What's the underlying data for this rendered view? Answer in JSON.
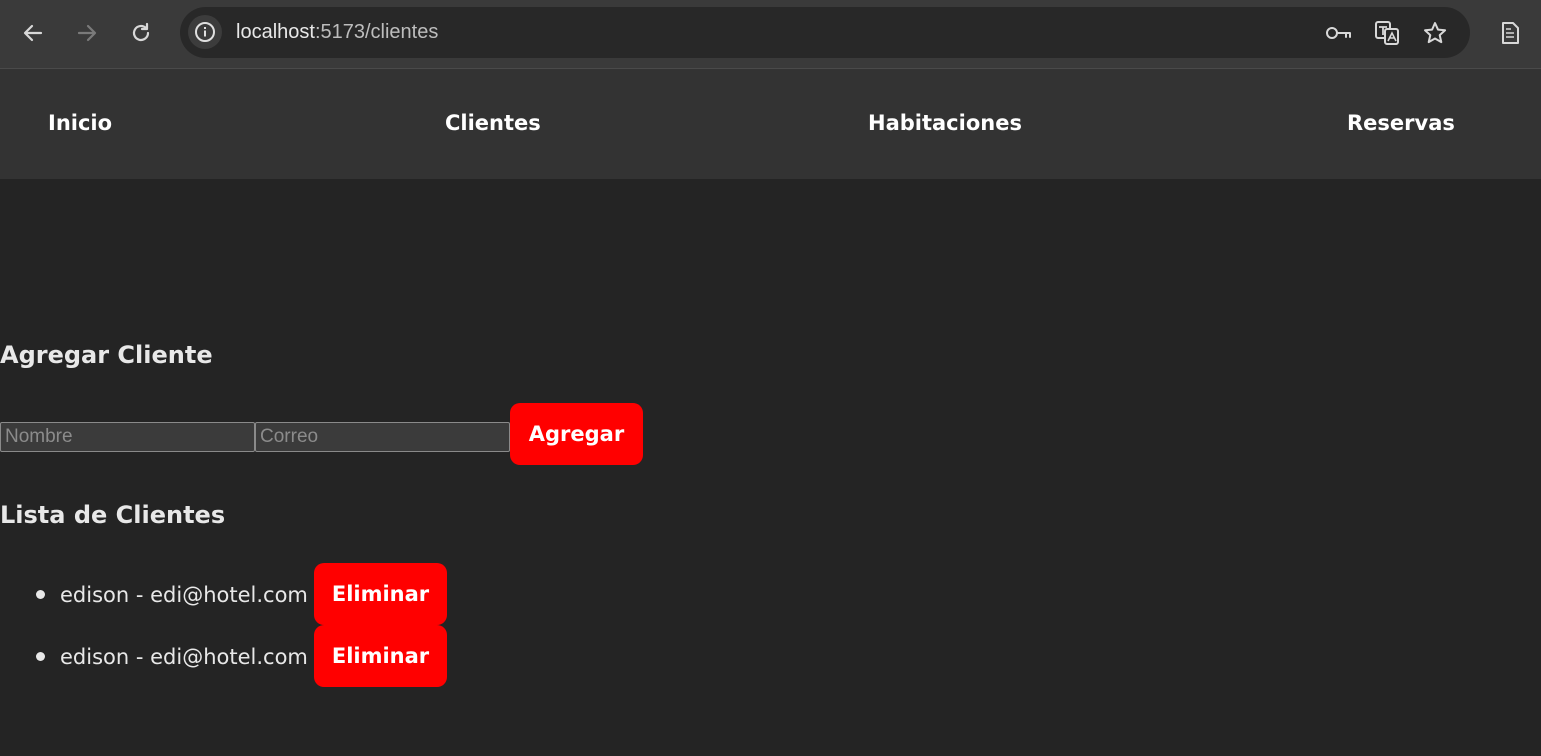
{
  "browser": {
    "url_host": "localhost",
    "url_path": ":5173/clientes",
    "icons": [
      "back-arrow-icon",
      "forward-arrow-icon",
      "reload-icon",
      "site-info-icon",
      "key-icon",
      "translate-icon",
      "star-icon",
      "reading-mode-icon"
    ]
  },
  "nav": {
    "items": [
      {
        "label": "Inicio"
      },
      {
        "label": "Clientes"
      },
      {
        "label": "Habitaciones"
      },
      {
        "label": "Reservas"
      }
    ]
  },
  "form": {
    "title": "Agregar Cliente",
    "name_placeholder": "Nombre",
    "email_placeholder": "Correo",
    "submit_label": "Agregar"
  },
  "list": {
    "title": "Lista de Clientes",
    "items": [
      {
        "text": "edison - edi@hotel.com",
        "action_label": "Eliminar"
      },
      {
        "text": "edison - edi@hotel.com",
        "action_label": "Eliminar"
      }
    ]
  },
  "colors": {
    "page_background": "#242424",
    "nav_background": "#333333",
    "accent_button": "#ff0000"
  }
}
